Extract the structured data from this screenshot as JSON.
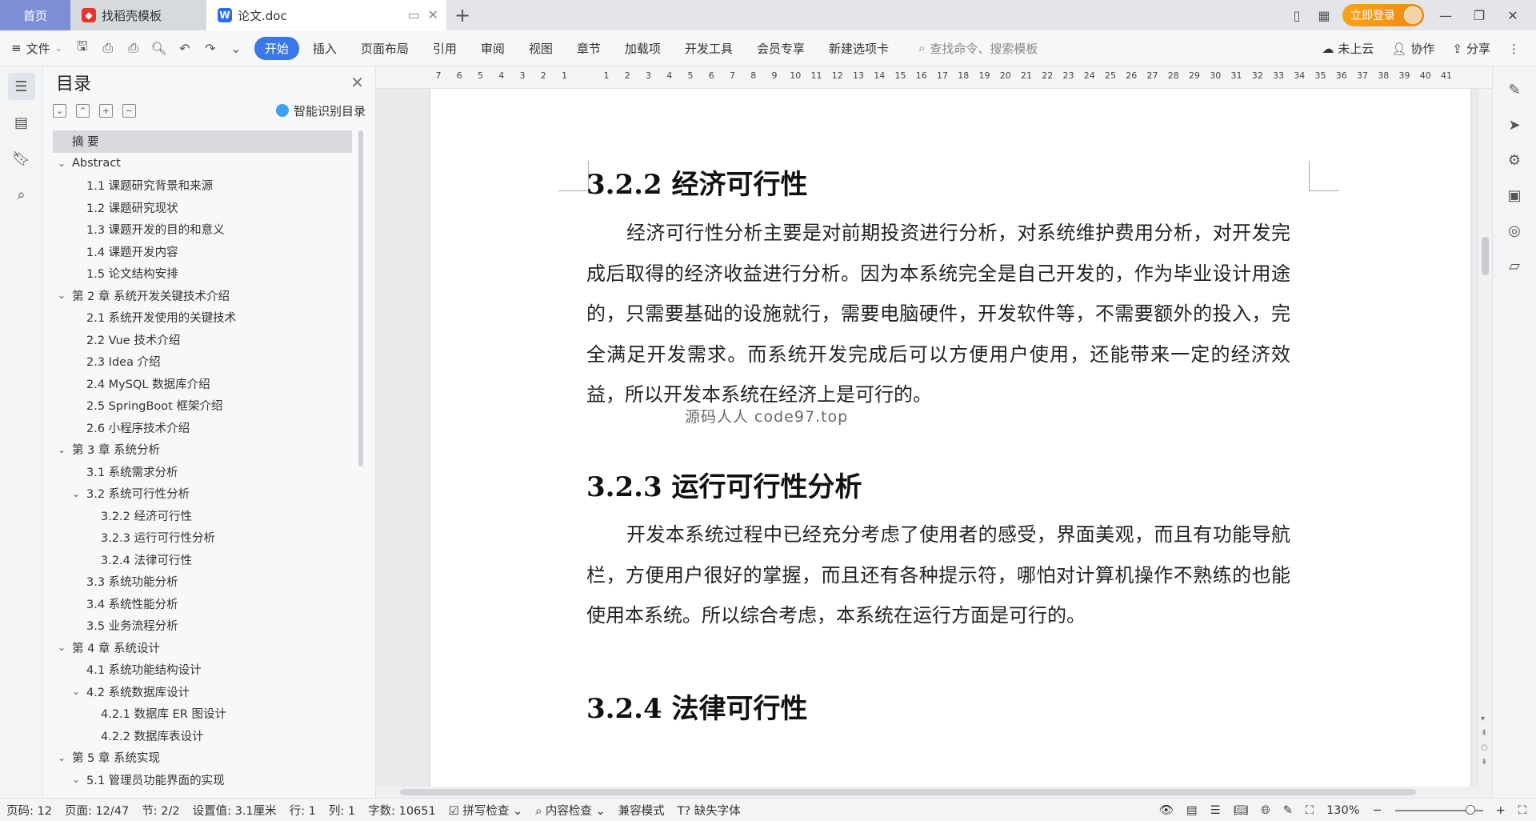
{
  "tabs": {
    "home": "首页",
    "template": "找稻壳模板",
    "doc": "论文.doc",
    "home_bg": "#7d8fd6"
  },
  "titlebar": {
    "login": "立即登录"
  },
  "toolbar": {
    "file": "文件",
    "menu": [
      "开始",
      "插入",
      "页面布局",
      "引用",
      "审阅",
      "视图",
      "章节",
      "加载项",
      "开发工具",
      "会员专享",
      "新建选项卡"
    ],
    "active_menu": "开始",
    "search_placeholder": "查找命令、搜索模板",
    "cloud": "未上云",
    "collab": "协作",
    "share": "分享",
    "accent": "#3b78e7"
  },
  "toc": {
    "title": "目录",
    "smart": "智能识别目录",
    "items": [
      {
        "text": "摘 要",
        "level": 0,
        "chev": "",
        "selected": true
      },
      {
        "text": "Abstract",
        "level": 0,
        "chev": "v"
      },
      {
        "text": "1.1 课题研究背景和来源",
        "level": 1,
        "chev": ""
      },
      {
        "text": "1.2 课题研究现状",
        "level": 1,
        "chev": ""
      },
      {
        "text": "1.3 课题开发的目的和意义",
        "level": 1,
        "chev": ""
      },
      {
        "text": "1.4 课题开发内容",
        "level": 1,
        "chev": ""
      },
      {
        "text": "1.5 论文结构安排",
        "level": 1,
        "chev": ""
      },
      {
        "text": "第 2 章  系统开发关键技术介绍",
        "level": 0,
        "chev": "v"
      },
      {
        "text": "2.1 系统开发使用的关键技术",
        "level": 1,
        "chev": ""
      },
      {
        "text": "2.2 Vue 技术介绍",
        "level": 1,
        "chev": ""
      },
      {
        "text": "2.3 Idea 介绍",
        "level": 1,
        "chev": ""
      },
      {
        "text": "2.4 MySQL 数据库介绍",
        "level": 1,
        "chev": ""
      },
      {
        "text": "2.5 SpringBoot 框架介绍",
        "level": 1,
        "chev": ""
      },
      {
        "text": "2.6 小程序技术介绍",
        "level": 1,
        "chev": ""
      },
      {
        "text": "第 3 章  系统分析",
        "level": 0,
        "chev": "v"
      },
      {
        "text": "3.1 系统需求分析",
        "level": 1,
        "chev": ""
      },
      {
        "text": "3.2 系统可行性分析",
        "level": 1,
        "chev": "v"
      },
      {
        "text": "3.2.2 经济可行性",
        "level": 2,
        "chev": ""
      },
      {
        "text": "3.2.3 运行可行性分析",
        "level": 2,
        "chev": ""
      },
      {
        "text": "3.2.4 法律可行性",
        "level": 2,
        "chev": ""
      },
      {
        "text": "3.3 系统功能分析",
        "level": 1,
        "chev": ""
      },
      {
        "text": "3.4 系统性能分析",
        "level": 1,
        "chev": ""
      },
      {
        "text": "3.5 业务流程分析",
        "level": 1,
        "chev": ""
      },
      {
        "text": "第 4 章  系统设计",
        "level": 0,
        "chev": "v"
      },
      {
        "text": "4.1 系统功能结构设计",
        "level": 1,
        "chev": ""
      },
      {
        "text": "4.2 系统数据库设计",
        "level": 1,
        "chev": "v"
      },
      {
        "text": "4.2.1 数据库 ER 图设计",
        "level": 2,
        "chev": ""
      },
      {
        "text": "4.2.2 数据库表设计",
        "level": 2,
        "chev": ""
      },
      {
        "text": "第 5 章  系统实现",
        "level": 0,
        "chev": "v"
      },
      {
        "text": "5.1 管理员功能界面的实现",
        "level": 1,
        "chev": "v"
      }
    ]
  },
  "ruler": [
    "7",
    "6",
    "5",
    "4",
    "3",
    "2",
    "1",
    "",
    "1",
    "2",
    "3",
    "4",
    "5",
    "6",
    "7",
    "8",
    "9",
    "10",
    "11",
    "12",
    "13",
    "14",
    "15",
    "16",
    "17",
    "18",
    "19",
    "20",
    "21",
    "22",
    "23",
    "24",
    "25",
    "26",
    "27",
    "28",
    "29",
    "30",
    "31",
    "32",
    "33",
    "34",
    "35",
    "36",
    "37",
    "38",
    "39",
    "40",
    "41"
  ],
  "document": {
    "h1": "3.2.2 经济可行性",
    "p1": "经济可行性分析主要是对前期投资进行分析，对系统维护费用分析，对开发完成后取得的经济收益进行分析。因为本系统完全是自己开发的，作为毕业设计用途的，只需要基础的设施就行，需要电脑硬件，开发软件等，不需要额外的投入，完全满足开发需求。而系统开发完成后可以方便用户使用，还能带来一定的经济效益，所以开发本系统在经济上是可行的。",
    "watermark": "源码人人 code97.top",
    "h2": "3.2.3 运行可行性分析",
    "p2": "开发本系统过程中已经充分考虑了使用者的感受，界面美观，而且有功能导航栏，方便用户很好的掌握，而且还有各种提示符，哪怕对计算机操作不熟练的也能使用本系统。所以综合考虑，本系统在运行方面是可行的。",
    "h3": "3.2.4 法律可行性"
  },
  "status": {
    "page_code": "页码: 12",
    "page": "页面: 12/47",
    "section": "节: 2/2",
    "setting": "设置值: 3.1厘米",
    "row": "行: 1",
    "col": "列: 1",
    "words": "字数: 10651",
    "spell": "拼写检查",
    "content_check": "内容检查",
    "compat": "兼容模式",
    "missing_font": "缺失字体",
    "zoom": "130%"
  }
}
